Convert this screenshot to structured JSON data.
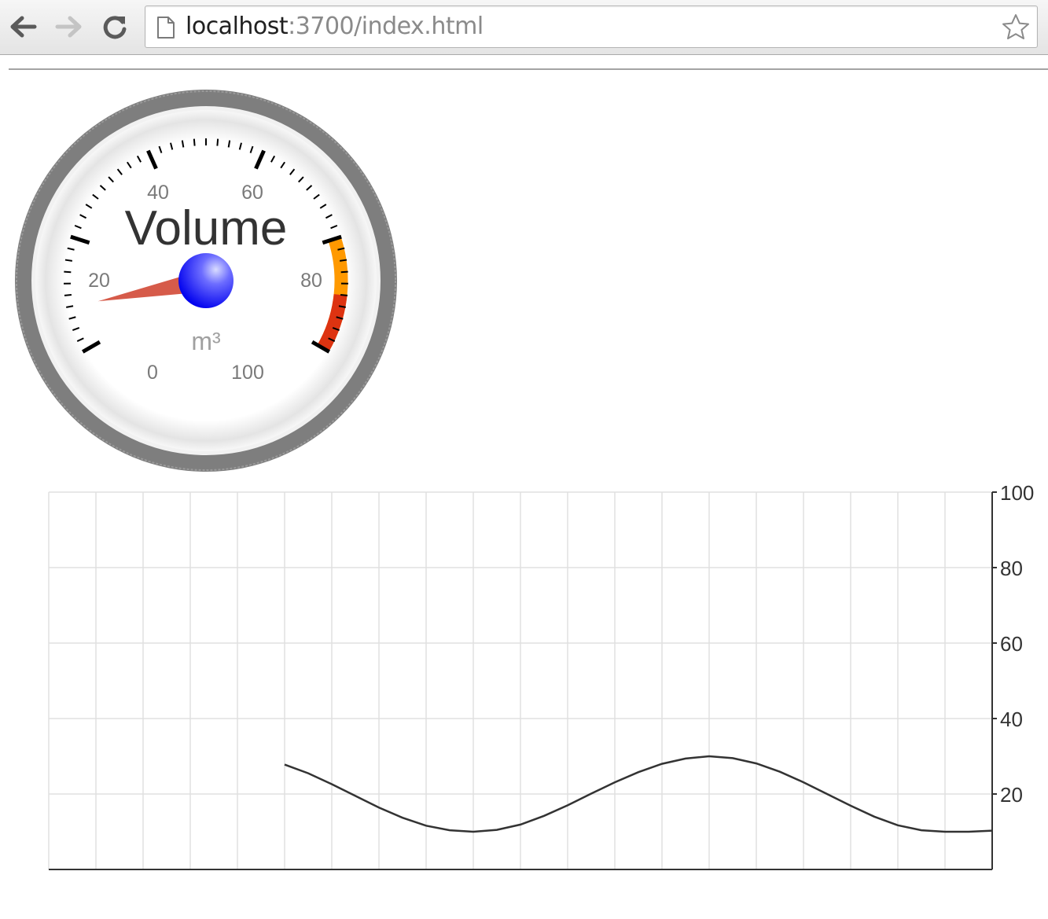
{
  "browser": {
    "url_host": "localhost",
    "url_rest": ":3700/index.html",
    "icons": {
      "back": "back-arrow-icon",
      "forward": "forward-arrow-icon",
      "reload": "reload-icon",
      "page": "page-icon",
      "bookmark": "star-icon"
    }
  },
  "gauge": {
    "title": "Volume",
    "units": "m³",
    "value": 8,
    "min": 0,
    "max": 100,
    "major_ticks": [
      "0",
      "20",
      "40",
      "60",
      "80",
      "100"
    ],
    "highlights": [
      {
        "from": 80,
        "to": 100,
        "color": "#ff9900"
      },
      {
        "from": 90,
        "to": 100,
        "color": "#dd3311"
      }
    ],
    "colors": {
      "bezel": "#7e7e7e",
      "needle": "#d65b4a",
      "hub": "#1010ff",
      "title": "#333333",
      "numbers": "#7a7a7a",
      "units": "#a0a0a0"
    }
  },
  "chart_data": {
    "type": "line",
    "title": "",
    "xlabel": "",
    "ylabel": "",
    "ylim": [
      0,
      100
    ],
    "y_ticks": [
      20,
      40,
      60,
      80,
      100
    ],
    "grid": true,
    "axis_side": "right",
    "x_cells": 20,
    "series": [
      {
        "line_color": "#333333",
        "x": [
          5.0,
          5.5,
          6.0,
          6.5,
          7.0,
          7.5,
          8.0,
          8.5,
          9.0,
          9.5,
          10.0,
          10.5,
          11.0,
          11.5,
          12.0,
          12.5,
          13.0,
          13.5,
          14.0,
          14.5,
          15.0,
          15.5,
          16.0,
          16.5,
          17.0,
          17.5,
          18.0,
          18.5,
          19.0,
          19.5,
          20.0
        ],
        "y": [
          27.8,
          25.5,
          22.6,
          19.5,
          16.4,
          13.7,
          11.6,
          10.4,
          10.0,
          10.5,
          11.9,
          14.2,
          17.0,
          20.1,
          23.1,
          25.8,
          28.0,
          29.4,
          30.0,
          29.5,
          28.1,
          25.9,
          23.1,
          20.0,
          16.9,
          14.0,
          11.7,
          10.4,
          10.0,
          10.0,
          10.3
        ]
      }
    ]
  }
}
